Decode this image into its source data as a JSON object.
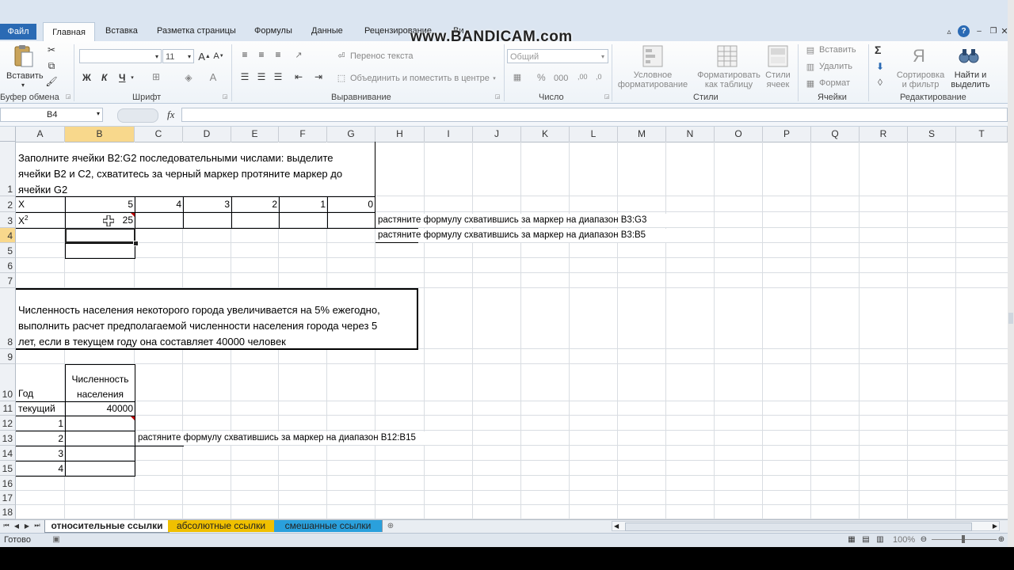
{
  "window": {
    "watermark": "www.BANDICAM.com",
    "file_tab": "Файл",
    "tabs": [
      "Главная",
      "Вставка",
      "Разметка страницы",
      "Формулы",
      "Данные",
      "Рецензирование",
      "Ви"
    ]
  },
  "ribbon": {
    "paste_label": "Вставить",
    "clipboard_group": "Буфер обмена",
    "font_group": "Шрифт",
    "font_size": "11",
    "bold": "Ж",
    "italic": "К",
    "underline": "Ч",
    "alignment_group": "Выравнивание",
    "wrap_text": "Перенос текста",
    "merge_center": "Объединить и поместить в центре",
    "number_group": "Число",
    "number_format": "Общий",
    "percent": "%",
    "thousands": "000",
    "inc_dec": ",00",
    "dec_dec": ",0",
    "styles_group": "Стили",
    "cond_format": [
      "Условное",
      "форматирование"
    ],
    "format_table": [
      "Форматировать",
      "как таблицу"
    ],
    "cell_styles": [
      "Стили",
      "ячеек"
    ],
    "cells_group": "Ячейки",
    "insert": "Вставить",
    "delete": "Удалить",
    "format": "Формат",
    "editing_group": "Редактирование",
    "sort_filter": [
      "Сортировка",
      "и фильтр"
    ],
    "find_select": [
      "Найти и",
      "выделить"
    ],
    "sigma": "Σ"
  },
  "formula_bar": {
    "name_box": "B4",
    "fx": "fx",
    "formula": ""
  },
  "columns": [
    "A",
    "B",
    "C",
    "D",
    "E",
    "F",
    "G",
    "H",
    "I",
    "J",
    "K",
    "L",
    "M",
    "N",
    "O",
    "P",
    "Q",
    "R",
    "S",
    "T"
  ],
  "rows": [
    "1",
    "2",
    "3",
    "4",
    "5",
    "6",
    "7",
    "8",
    "9",
    "10",
    "11",
    "12",
    "13",
    "14",
    "15",
    "16",
    "17",
    "18"
  ],
  "cells": {
    "A1": [
      "Заполните ячейки B2:G2 последовательными числами: выделите",
      "ячейки B2 и C2, схватитесь за черный маркер протяните маркер до",
      "ячейки G2"
    ],
    "A2": "X",
    "B2": "5",
    "C2": "4",
    "D2": "3",
    "E2": "2",
    "F2": "1",
    "G2": "0",
    "A3_base": "X",
    "A3_sup": "2",
    "B3": "25",
    "H3": "растяните формулу схватившись за маркер на диапазон  B3:G3",
    "H4": "растяните формулу схватившись за маркер на диапазон  B3:B5",
    "A8": [
      "Численность населения некоторого города увеличивается на 5% ежегодно,",
      "выполнить расчет предполагаемой численности населения города через 5",
      "лет, если в текущем году она составляет 40000 человек"
    ],
    "A10": "Год",
    "B10": [
      "Численность",
      "населения"
    ],
    "A11": "текущий",
    "B11": "40000",
    "A12": "1",
    "A13": "2",
    "A14": "3",
    "A15": "4",
    "C13": "растяните формулу схватившись за маркер на диапазон  B12:B15"
  },
  "sheets": {
    "tabs": [
      "относительные ссылки",
      "абсолютные ссылки",
      "смешанные ссылки"
    ],
    "active": "относительные ссылки",
    "tab_colors": [
      "#ffffff",
      "#f0c000",
      "#2aa0dc"
    ]
  },
  "status": {
    "ready": "Готово",
    "zoom": "100%"
  }
}
